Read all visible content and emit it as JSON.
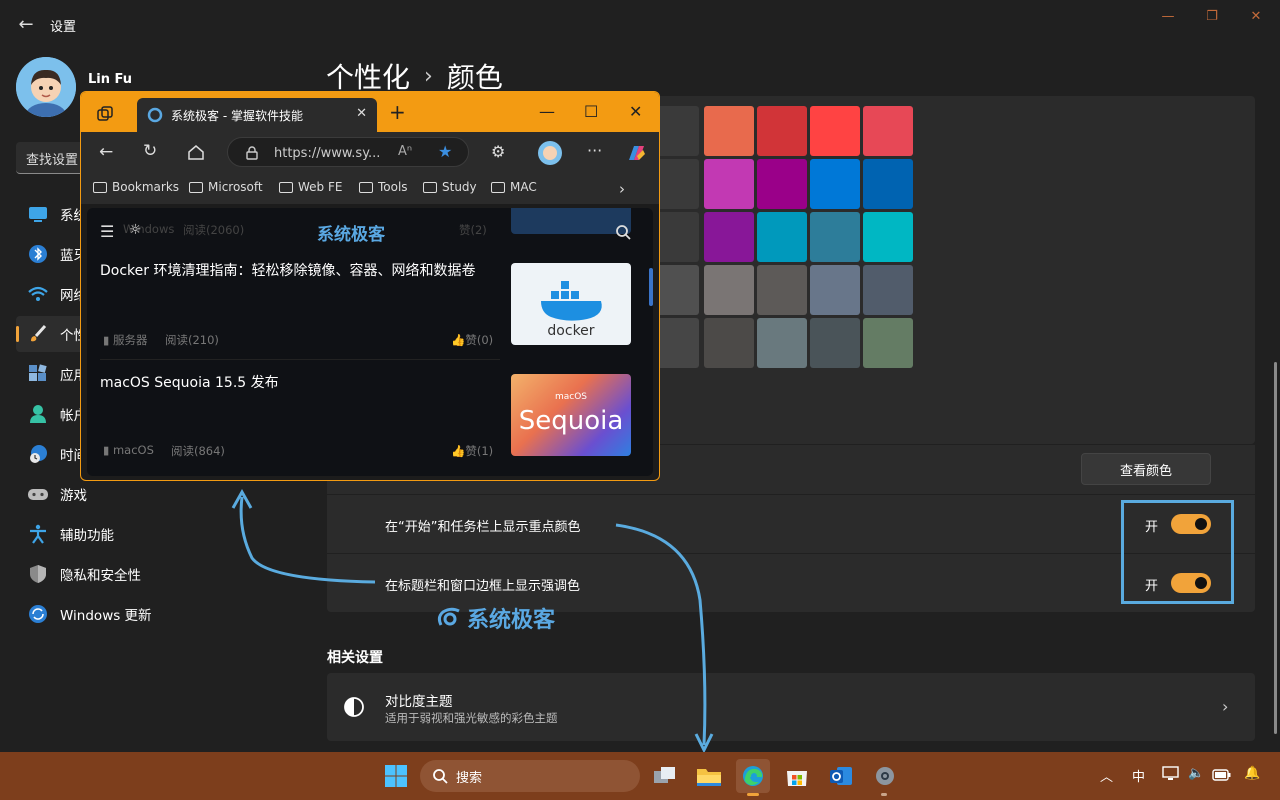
{
  "window": {
    "title": "设置",
    "back_icon": "back-arrow-icon",
    "controls": [
      "minimize-icon",
      "maximize-icon",
      "close-icon"
    ]
  },
  "user": {
    "name": "Lin Fu",
    "avatar": "user-avatar"
  },
  "sidebar": {
    "search_placeholder": "查找设置",
    "items": [
      {
        "label": "系统",
        "icon": "system-icon"
      },
      {
        "label": "蓝牙",
        "icon": "bluetooth-icon"
      },
      {
        "label": "网络",
        "icon": "wifi-icon"
      },
      {
        "label": "个性化",
        "icon": "brush-icon",
        "selected": true
      },
      {
        "label": "应用",
        "icon": "apps-icon"
      },
      {
        "label": "帐户",
        "icon": "account-icon"
      },
      {
        "label": "时间",
        "icon": "clock-icon"
      },
      {
        "label": "游戏",
        "icon": "gamepad-icon"
      },
      {
        "label": "辅助功能",
        "icon": "accessibility-icon"
      },
      {
        "label": "隐私和安全性",
        "icon": "shield-icon"
      },
      {
        "label": "Windows 更新",
        "icon": "update-icon"
      }
    ]
  },
  "main": {
    "breadcrumb": {
      "parent": "个性化",
      "separator": "›",
      "current": "颜色"
    },
    "swatches": [
      [
        "#e86a4d",
        "#d13438",
        "#ff4343",
        "#e74856"
      ],
      [
        "#c239b3",
        "#9a0089",
        "#0078d7",
        "#0063b1"
      ],
      [
        "#881798",
        "#0099bc",
        "#2d7d9a",
        "#00b7c3"
      ],
      [
        "#7a7574",
        "#5d5a58",
        "#68768a",
        "#515c6b"
      ],
      [
        "#4c4a48",
        "#69797e",
        "#4a5459",
        "#647c64"
      ]
    ],
    "view_colors_button": "查看颜色",
    "options": [
      {
        "label": "在“开始”和任务栏上显示重点颜色",
        "state_label": "开",
        "on": true
      },
      {
        "label": "在标题栏和窗口边框上显示强调色",
        "state_label": "开",
        "on": true
      }
    ],
    "watermark": "系统极客",
    "related": {
      "title": "相关设置",
      "contrast_title": "对比度主题",
      "contrast_subtitle": "适用于弱视和强光敏感的彩色主题"
    },
    "accent_color": "#f1a33a"
  },
  "edge": {
    "tab_title": "系统极客 - 掌握软件技能",
    "url": "https://www.sy...",
    "new_tab": "+",
    "bookmarks": [
      "Bookmarks",
      "Microsoft",
      "Web FE",
      "Tools",
      "Study",
      "MAC"
    ],
    "site_logo": "系统极客",
    "partial_row": {
      "meta_left": "Windows",
      "views": "阅读(2060)",
      "likes": "赞(2)"
    },
    "articles": [
      {
        "title": "Docker 环境清理指南：轻松移除镜像、容器、网络和数据卷",
        "category": "服务器",
        "views": "阅读(210)",
        "likes": "赞(0)",
        "thumb_text": "docker"
      },
      {
        "title": "macOS Sequoia 15.5 发布",
        "category": "macOS",
        "views": "阅读(864)",
        "likes": "赞(1)",
        "thumb_small": "macOS",
        "thumb_text": "Sequoia"
      }
    ],
    "frame_color": "#f39b12"
  },
  "taskbar": {
    "search_label": "搜索",
    "apps": [
      "task-view-icon",
      "file-explorer-icon",
      "edge-icon",
      "store-icon",
      "outlook-icon",
      "settings-icon"
    ],
    "tray": {
      "ime": "中"
    }
  }
}
